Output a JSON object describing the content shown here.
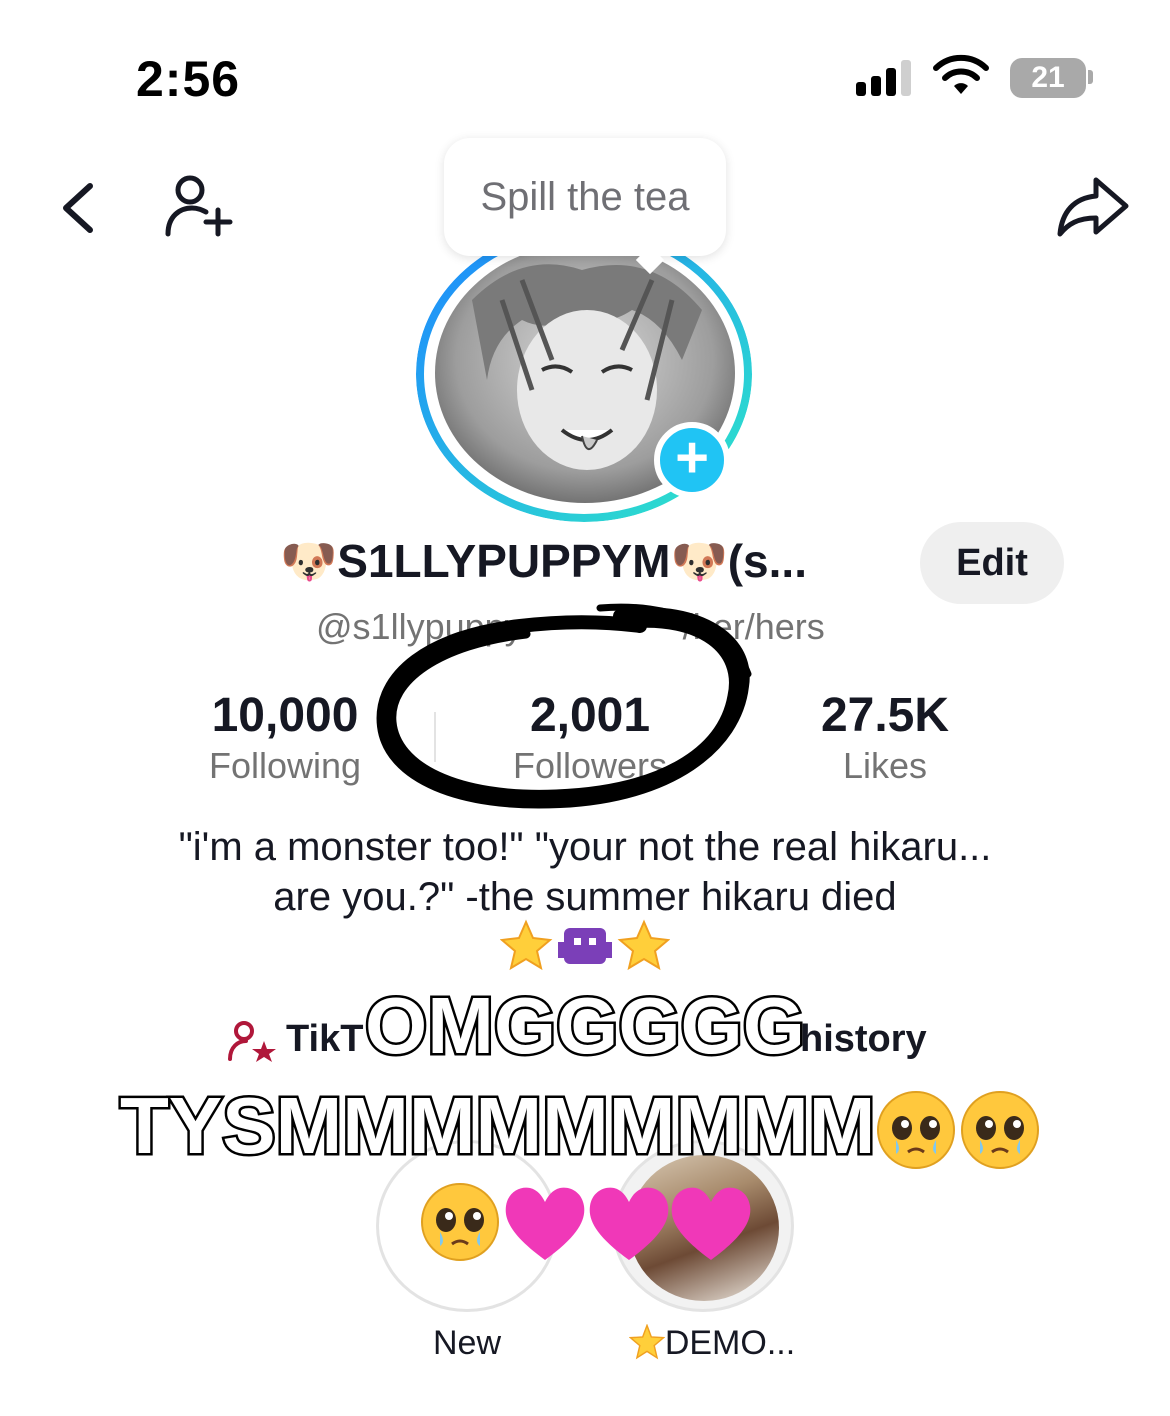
{
  "status_bar": {
    "time": "2:56",
    "battery": "21"
  },
  "nav": {
    "back_icon": "chevron-left-icon",
    "add_user_icon": "person-plus-icon",
    "share_icon": "share-arrow-icon"
  },
  "tooltip": {
    "text": "Spill the tea"
  },
  "profile": {
    "display_name": "🐶S1LLYPUPPYM🐶(s...",
    "username": "@s1llypuppy",
    "username_suffix": "/her/hers",
    "edit_label": "Edit",
    "add_story_label": "+"
  },
  "stats": {
    "following_value": "10,000",
    "following_label": "Following",
    "followers_value": "2,001",
    "followers_label": "Followers",
    "likes_value": "27.5K",
    "likes_label": "Likes"
  },
  "bio": {
    "line1": "\"i'm a monster too!\" \"your not the real hikaru...",
    "line2": "are you.?\" -the summer hikaru died"
  },
  "links": {
    "studio_label": "TikT",
    "history_label": "history"
  },
  "overlay": {
    "line1": "OMGGGGG",
    "line2": "TYSMMMMMMMMM"
  },
  "highlights": [
    {
      "label": "New"
    },
    {
      "label": "DEMO..."
    }
  ],
  "colors": {
    "accent_blue": "#20c4f4",
    "ring_start": "#1e88ff",
    "ring_end": "#2ee6c8",
    "text_primary": "#161823",
    "text_secondary": "#737373",
    "studio_icon": "#b0173a"
  }
}
